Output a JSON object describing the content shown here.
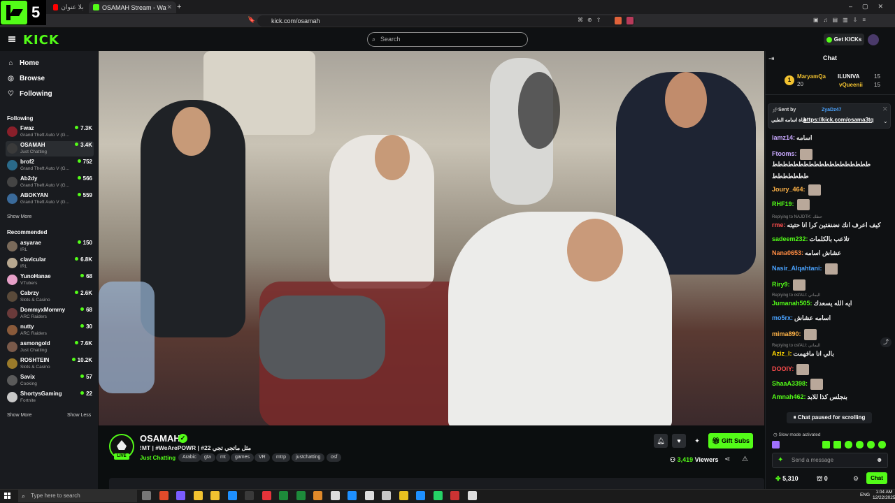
{
  "browser": {
    "tabs": [
      {
        "title": "بلا عنوان - YouTube"
      },
      {
        "title": "OSAMAH Stream - Watch Live"
      }
    ],
    "url": "kick.com/osamah"
  },
  "overlay": {
    "logo_number": "5"
  },
  "header": {
    "logo": "KICK",
    "search_placeholder": "Search",
    "get_kicks": "Get KICKs"
  },
  "sidebar": {
    "nav": [
      {
        "label": "Home",
        "icon": "home-icon"
      },
      {
        "label": "Browse",
        "icon": "compass-icon"
      },
      {
        "label": "Following",
        "icon": "heart-icon"
      }
    ],
    "following_title": "Following",
    "following": [
      {
        "name": "Fwaz",
        "category": "Grand Theft Auto V (G...",
        "viewers": "7.3K",
        "color": "#8a1f2a"
      },
      {
        "name": "OSAMAH",
        "category": "Just Chatting",
        "viewers": "3.4K",
        "color": "#3a3a3a"
      },
      {
        "name": "brof2",
        "category": "Grand Theft Auto V (G...",
        "viewers": "752",
        "color": "#2a6a8a"
      },
      {
        "name": "Ab2dy",
        "category": "Grand Theft Auto V (G...",
        "viewers": "566",
        "color": "#444"
      },
      {
        "name": "ABOKYAN",
        "category": "Grand Theft Auto V (G...",
        "viewers": "559",
        "color": "#3a6a9a"
      }
    ],
    "show_more_following": "Show More",
    "recommended_title": "Recommended",
    "recommended": [
      {
        "name": "asyarae",
        "category": "IRL",
        "viewers": "150",
        "color": "#7a6a5a"
      },
      {
        "name": "clavicular",
        "category": "IRL",
        "viewers": "6.8K",
        "color": "#b8a890"
      },
      {
        "name": "YunoHanae",
        "category": "VTubers",
        "viewers": "68",
        "color": "#e7a0c8"
      },
      {
        "name": "Cabrzy",
        "category": "Slots & Casino",
        "viewers": "2.6K",
        "color": "#5a4a3a"
      },
      {
        "name": "DommyxMommy",
        "category": "ARC Raiders",
        "viewers": "68",
        "color": "#6a3a3a"
      },
      {
        "name": "nutty",
        "category": "ARC Raiders",
        "viewers": "30",
        "color": "#8a5a3a"
      },
      {
        "name": "asmongold",
        "category": "Just Chatting",
        "viewers": "7.6K",
        "color": "#7a5a4a"
      },
      {
        "name": "ROSHTEIN",
        "category": "Slots & Casino",
        "viewers": "10.2K",
        "color": "#9a7a2a"
      },
      {
        "name": "Savix",
        "category": "Cooking",
        "viewers": "57",
        "color": "#5a5a5a"
      },
      {
        "name": "ShortysGaming",
        "category": "Fortnite",
        "viewers": "22",
        "color": "#c8c8c8"
      }
    ],
    "show_more": "Show More",
    "show_less": "Show Less"
  },
  "stream": {
    "channel": "OSAMAH",
    "live_badge": "LIVE",
    "title": "!MT | #WeArePOWR | #22 مثل ماتجي تجي",
    "category": "Just Chatting",
    "tags": [
      "Arabic",
      "gta",
      "mt",
      "games",
      "VR",
      "mtrp",
      "justchatting",
      "osf"
    ],
    "gift_subs": "Gift Subs",
    "viewers": "3,419",
    "viewers_label": "Viewers"
  },
  "chat": {
    "title": "Chat",
    "leaderboard": [
      {
        "name": "MaryamQa",
        "score": "20"
      },
      {
        "name": "ILUNIVA",
        "score": "15"
      },
      {
        "name": "vQueenii",
        "score": "15"
      }
    ],
    "pinned": {
      "sent_by_label": "Sent by",
      "sender": "ZyaDz47",
      "link": "https://kick.com/osama3tq",
      "text": "قناة اسامه الطبي"
    },
    "messages": [
      {
        "user": "lamz14:",
        "text": "اسامه",
        "color": "#c9a9ff"
      },
      {
        "user": "Ftooms:",
        "text": "",
        "color": "#c9a9ff"
      },
      {
        "user": "",
        "text": "ططططططططططططططططططط",
        "color": "#eee"
      },
      {
        "user": "",
        "text": "ططططططط",
        "color": "#eee"
      },
      {
        "user": "Joury_464:",
        "text": "",
        "color": "#ffb347"
      },
      {
        "user": "RHF19:",
        "text": "",
        "color": "#53fc18"
      },
      {
        "user": "rme:",
        "text": "كيف اعرف انك نضنفتين كرا انا حتيته",
        "color": "#ff4d4d"
      },
      {
        "user": "sadeem232:",
        "text": "تلاعب بالكلمات",
        "color": "#53fc18"
      },
      {
        "user": "Nana0653:",
        "text": "عشاش اسامه",
        "color": "#ff8c42"
      },
      {
        "user": "Nasir_Alqahtani:",
        "text": "",
        "color": "#4aa3ff"
      },
      {
        "user": "Riry9:",
        "text": "",
        "color": "#53fc18"
      },
      {
        "user": "Jumanah505:",
        "text": "ايه الله يسعدك",
        "color": "#53fc18"
      },
      {
        "user": "mo5rx:",
        "text": "اسامه عشاش",
        "color": "#4aa3ff"
      },
      {
        "user": "mima890:",
        "text": "",
        "color": "#ffb347"
      },
      {
        "user": "Aziz_l:",
        "text": "بالي انا مافهمت",
        "color": "#ffd700"
      },
      {
        "user": "DOOIY:",
        "text": "",
        "color": "#ff4d4d"
      },
      {
        "user": "ShaaA3398:",
        "text": "",
        "color": "#53fc18"
      },
      {
        "user": "Amnah462:",
        "text": "بنجلس كذا للابد",
        "color": "#53fc18"
      },
      {
        "user": "",
        "text": "ططططططططططططططططططط",
        "color": "#eee"
      },
      {
        "user": "",
        "text": "ططططط",
        "color": "#eee"
      }
    ],
    "replies": [
      {
        "text": "Replying to NAJDTK: حطك"
      },
      {
        "text": "Replying to osfALI: اليماتي"
      },
      {
        "text": "Replying to osfALI: اليماتي"
      }
    ],
    "paused": "Chat paused for scrolling",
    "slow_mode": "Slow mode activated",
    "placeholder": "Send a message",
    "kicks_balance": "5,310",
    "points": "0",
    "send_button": "Chat"
  },
  "taskbar": {
    "search_placeholder": "Type here to search",
    "lang": "ENG",
    "time": "1:04 AM",
    "date": "12/22/2025"
  }
}
